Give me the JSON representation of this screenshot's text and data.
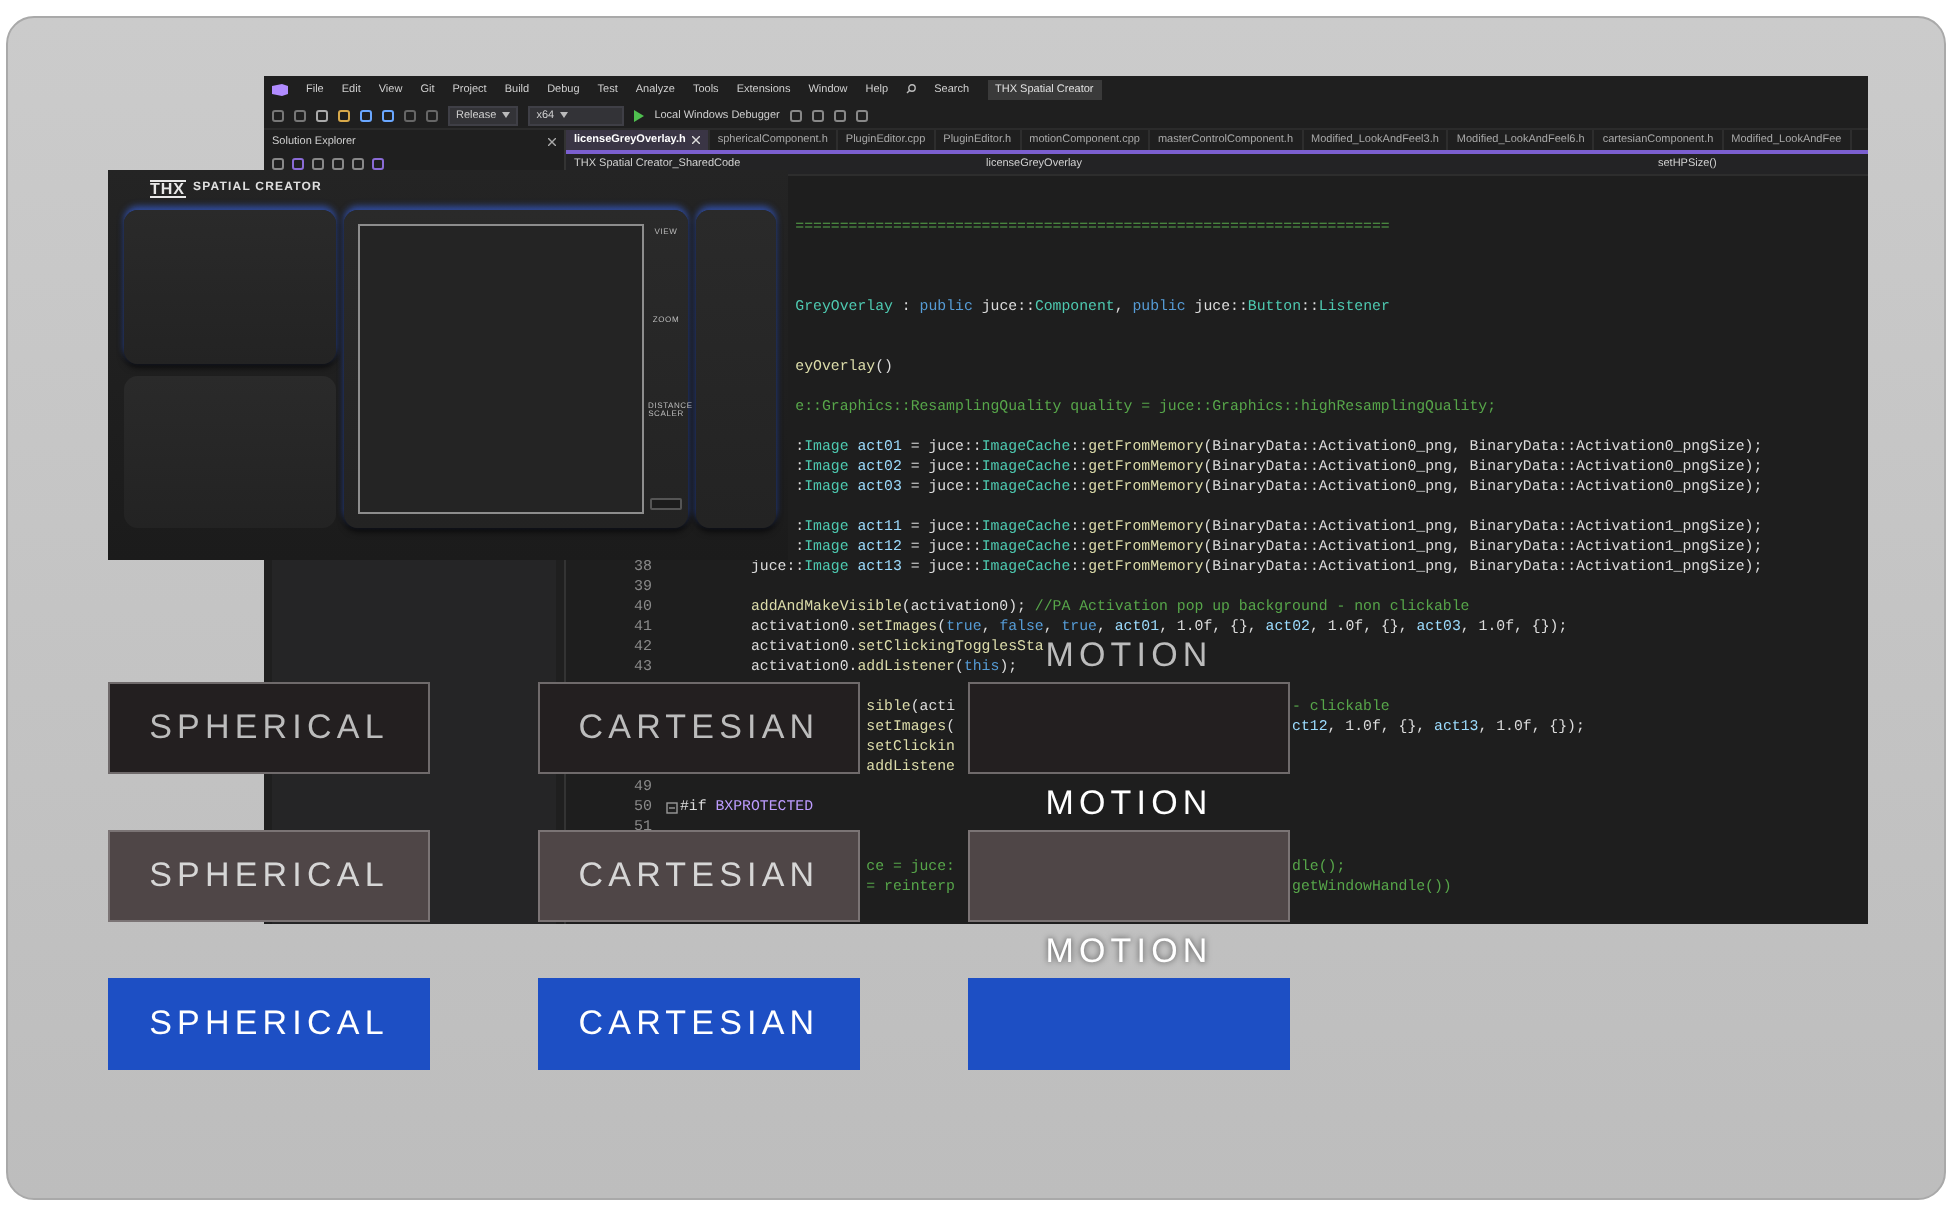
{
  "ide": {
    "menu": [
      "File",
      "Edit",
      "View",
      "Git",
      "Project",
      "Build",
      "Debug",
      "Test",
      "Analyze",
      "Tools",
      "Extensions",
      "Window",
      "Help"
    ],
    "search": "Search",
    "solution": "THX Spatial Creator",
    "toolbar": {
      "configuration": "Release",
      "platform": "x64",
      "debugger": "Local Windows Debugger"
    },
    "solution_explorer": {
      "title": "Solution Explorer"
    },
    "tabs": [
      {
        "label": "licenseGreyOverlay.h",
        "selected": true
      },
      {
        "label": "sphericalComponent.h",
        "selected": false
      },
      {
        "label": "PluginEditor.cpp",
        "selected": false
      },
      {
        "label": "PluginEditor.h",
        "selected": false
      },
      {
        "label": "motionComponent.cpp",
        "selected": false
      },
      {
        "label": "masterControlComponent.h",
        "selected": false
      },
      {
        "label": "Modified_LookAndFeel3.h",
        "selected": false
      },
      {
        "label": "Modified_LookAndFeel6.h",
        "selected": false
      },
      {
        "label": "cartesianComponent.h",
        "selected": false
      },
      {
        "label": "Modified_LookAndFee",
        "selected": false
      }
    ],
    "nav": {
      "project": "THX Spatial Creator_SharedCode",
      "scope": "licenseGreyOverlay",
      "member": "setHPSize()"
    },
    "code": [
      {
        "tokens": [
          {
            "text": "             ===================================================================",
            "kind": "comment"
          }
        ]
      },
      {
        "kind": "blank"
      },
      {
        "kind": "blank"
      },
      {
        "kind": "blank"
      },
      {
        "tokens": [
          {
            "text": "             GreyOverlay",
            "kind": "type"
          },
          {
            "text": " : ",
            "kind": "plain"
          },
          {
            "text": "public",
            "kind": "keyword"
          },
          {
            "text": " juce::",
            "kind": "plain"
          },
          {
            "text": "Component",
            "kind": "type"
          },
          {
            "text": ", ",
            "kind": "plain"
          },
          {
            "text": "public",
            "kind": "keyword"
          },
          {
            "text": " juce::",
            "kind": "plain"
          },
          {
            "text": "Button",
            "kind": "type"
          },
          {
            "text": "::",
            "kind": "plain"
          },
          {
            "text": "Listener",
            "kind": "type"
          }
        ]
      },
      {
        "kind": "blank"
      },
      {
        "kind": "blank"
      },
      {
        "tokens": [
          {
            "text": "             eyOverlay",
            "kind": "function"
          },
          {
            "text": "()",
            "kind": "plain"
          }
        ]
      },
      {
        "kind": "blank"
      },
      {
        "tokens": [
          {
            "text": "             e::Graphics::ResamplingQuality quality = juce::Graphics::highResamplingQuality;",
            "kind": "comment"
          }
        ]
      },
      {
        "kind": "blank"
      },
      {
        "tokens": [
          {
            "text": "             :",
            "kind": "plain"
          },
          {
            "text": "Image",
            "kind": "type"
          },
          {
            "text": " act01",
            "kind": "variable"
          },
          {
            "text": " = juce::",
            "kind": "plain"
          },
          {
            "text": "ImageCache",
            "kind": "type"
          },
          {
            "text": "::",
            "kind": "plain"
          },
          {
            "text": "getFromMemory",
            "kind": "function"
          },
          {
            "text": "(BinaryData::Activation0_png, BinaryData::Activation0_pngSize);",
            "kind": "plain"
          }
        ]
      },
      {
        "tokens": [
          {
            "text": "             :",
            "kind": "plain"
          },
          {
            "text": "Image",
            "kind": "type"
          },
          {
            "text": " act02",
            "kind": "variable"
          },
          {
            "text": " = juce::",
            "kind": "plain"
          },
          {
            "text": "ImageCache",
            "kind": "type"
          },
          {
            "text": "::",
            "kind": "plain"
          },
          {
            "text": "getFromMemory",
            "kind": "function"
          },
          {
            "text": "(BinaryData::Activation0_png, BinaryData::Activation0_pngSize);",
            "kind": "plain"
          }
        ]
      },
      {
        "tokens": [
          {
            "text": "             :",
            "kind": "plain"
          },
          {
            "text": "Image",
            "kind": "type"
          },
          {
            "text": " act03",
            "kind": "variable"
          },
          {
            "text": " = juce::",
            "kind": "plain"
          },
          {
            "text": "ImageCache",
            "kind": "type"
          },
          {
            "text": "::",
            "kind": "plain"
          },
          {
            "text": "getFromMemory",
            "kind": "function"
          },
          {
            "text": "(BinaryData::Activation0_png, BinaryData::Activation0_pngSize);",
            "kind": "plain"
          }
        ]
      },
      {
        "kind": "blank"
      },
      {
        "tokens": [
          {
            "text": "             :",
            "kind": "plain"
          },
          {
            "text": "Image",
            "kind": "type"
          },
          {
            "text": " act11",
            "kind": "variable"
          },
          {
            "text": " = juce::",
            "kind": "plain"
          },
          {
            "text": "ImageCache",
            "kind": "type"
          },
          {
            "text": "::",
            "kind": "plain"
          },
          {
            "text": "getFromMemory",
            "kind": "function"
          },
          {
            "text": "(BinaryData::Activation1_png, BinaryData::Activation1_pngSize);",
            "kind": "plain"
          }
        ]
      },
      {
        "tokens": [
          {
            "text": "             :",
            "kind": "plain"
          },
          {
            "text": "Image",
            "kind": "type"
          },
          {
            "text": " act12",
            "kind": "variable"
          },
          {
            "text": " = juce::",
            "kind": "plain"
          },
          {
            "text": "ImageCache",
            "kind": "type"
          },
          {
            "text": "::",
            "kind": "plain"
          },
          {
            "text": "getFromMemory",
            "kind": "function"
          },
          {
            "text": "(BinaryData::Activation1_png, BinaryData::Activation1_pngSize);",
            "kind": "plain"
          }
        ]
      },
      {
        "number": "38",
        "tokens": [
          {
            "text": "        juce::",
            "kind": "plain"
          },
          {
            "text": "Image",
            "kind": "type"
          },
          {
            "text": " act13",
            "kind": "variable"
          },
          {
            "text": " = juce::",
            "kind": "plain"
          },
          {
            "text": "ImageCache",
            "kind": "type"
          },
          {
            "text": "::",
            "kind": "plain"
          },
          {
            "text": "getFromMemory",
            "kind": "function"
          },
          {
            "text": "(BinaryData::Activation1_png, BinaryData::Activation1_pngSize);",
            "kind": "plain"
          }
        ]
      },
      {
        "number": "39"
      },
      {
        "number": "40",
        "tokens": [
          {
            "text": "        addAndMakeVisible",
            "kind": "function"
          },
          {
            "text": "(activation0); ",
            "kind": "plain"
          },
          {
            "text": "//PA Activation pop up background - non clickable",
            "kind": "comment"
          }
        ]
      },
      {
        "number": "41",
        "tokens": [
          {
            "text": "        activation0.",
            "kind": "plain"
          },
          {
            "text": "setImages",
            "kind": "function"
          },
          {
            "text": "(",
            "kind": "plain"
          },
          {
            "text": "true",
            "kind": "keyword"
          },
          {
            "text": ", ",
            "kind": "plain"
          },
          {
            "text": "false",
            "kind": "keyword"
          },
          {
            "text": ", ",
            "kind": "plain"
          },
          {
            "text": "true",
            "kind": "keyword"
          },
          {
            "text": ", ",
            "kind": "plain"
          },
          {
            "text": "act01",
            "kind": "variable"
          },
          {
            "text": ", 1.0f, {}, ",
            "kind": "plain"
          },
          {
            "text": "act02",
            "kind": "variable"
          },
          {
            "text": ", 1.0f, {}, ",
            "kind": "plain"
          },
          {
            "text": "act03",
            "kind": "variable"
          },
          {
            "text": ", 1.0f, {});",
            "kind": "plain"
          }
        ]
      },
      {
        "number": "42",
        "tokens": [
          {
            "text": "        activation0.",
            "kind": "plain"
          },
          {
            "text": "setClickingTogglesSta",
            "kind": "function"
          }
        ]
      },
      {
        "number": "43",
        "tokens": [
          {
            "text": "        activation0.",
            "kind": "plain"
          },
          {
            "text": "addListener",
            "kind": "function"
          },
          {
            "text": "(",
            "kind": "plain"
          },
          {
            "text": "this",
            "kind": "keyword"
          },
          {
            "text": ");",
            "kind": "plain"
          }
        ]
      },
      {
        "kind": "blank"
      },
      {
        "tokens": [
          {
            "text": "                     sible",
            "kind": "function"
          },
          {
            "text": "(acti",
            "kind": "plain"
          },
          {
            "text": "                                      - clickable",
            "kind": "comment"
          }
        ]
      },
      {
        "tokens": [
          {
            "text": "                     setImages",
            "kind": "function"
          },
          {
            "text": "(",
            "kind": "plain"
          },
          {
            "text": "                                      ct12",
            "kind": "variable"
          },
          {
            "text": ", 1.0f, {}, ",
            "kind": "plain"
          },
          {
            "text": "act13",
            "kind": "variable"
          },
          {
            "text": ", 1.0f, {});",
            "kind": "plain"
          }
        ]
      },
      {
        "tokens": [
          {
            "text": "                     setClickin",
            "kind": "function"
          }
        ]
      },
      {
        "tokens": [
          {
            "text": "                     addListene",
            "kind": "function"
          }
        ]
      },
      {
        "number": "49"
      },
      {
        "number": "50",
        "fold": true,
        "tokens": [
          {
            "text": "#if ",
            "kind": "plain"
          },
          {
            "text": "BXPROTECTED",
            "kind": "macro"
          }
        ]
      },
      {
        "number": "51"
      },
      {
        "kind": "blank"
      },
      {
        "tokens": [
          {
            "text": "                     ce = juce:",
            "kind": "comment"
          },
          {
            "text": "                                      dle();",
            "kind": "comment"
          }
        ]
      },
      {
        "tokens": [
          {
            "text": "                     = reinterp",
            "kind": "comment"
          },
          {
            "text": "                                      getWindowHandle())",
            "kind": "comment"
          }
        ]
      }
    ]
  },
  "plugin": {
    "logo": "THX",
    "name": "SPATIAL CREATOR",
    "side_labels": [
      "VIEW",
      "ZOOM",
      "DISTANCE SCALER"
    ]
  },
  "button_states": [
    {
      "kind": "normal",
      "buttons": [
        {
          "kind": "labeled",
          "label": "SPHERICAL"
        },
        {
          "kind": "labeled",
          "label": "CARTESIAN"
        },
        {
          "kind": "captioned",
          "label": "MOTION"
        }
      ]
    },
    {
      "kind": "hover",
      "buttons": [
        {
          "kind": "labeled",
          "label": "SPHERICAL"
        },
        {
          "kind": "labeled",
          "label": "CARTESIAN"
        },
        {
          "kind": "captioned",
          "label": "MOTION"
        }
      ]
    },
    {
      "kind": "pressed",
      "buttons": [
        {
          "kind": "labeled",
          "label": "SPHERICAL"
        },
        {
          "kind": "labeled",
          "label": "CARTESIAN"
        },
        {
          "kind": "captioned",
          "label": "MOTION"
        }
      ]
    }
  ]
}
